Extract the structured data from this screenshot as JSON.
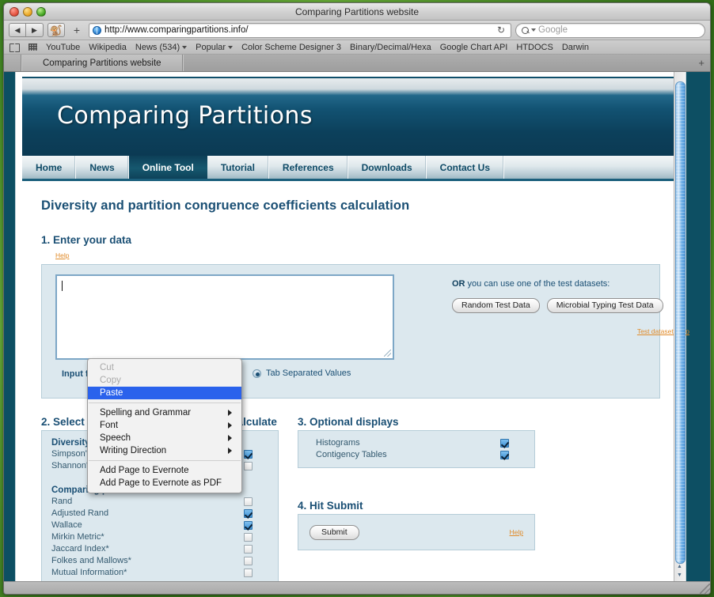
{
  "window": {
    "title": "Comparing Partitions website",
    "traffic_lights": [
      "close",
      "minimize",
      "zoom"
    ]
  },
  "toolbar": {
    "back_icon": "back-arrow-icon",
    "forward_icon": "forward-arrow-icon",
    "evernote_icon": "evernote-elephant-icon",
    "plus_label": "+",
    "url": "http://www.comparingpartitions.info/",
    "reload_glyph": "↻",
    "search_placeholder": "Google"
  },
  "bookmarks": [
    {
      "label": "YouTube",
      "menu": false
    },
    {
      "label": "Wikipedia",
      "menu": false
    },
    {
      "label": "News (534)",
      "menu": true
    },
    {
      "label": "Popular",
      "menu": true
    },
    {
      "label": "Color Scheme Designer 3",
      "menu": false
    },
    {
      "label": "Binary/Decimal/Hexa",
      "menu": false
    },
    {
      "label": "Google Chart API",
      "menu": false
    },
    {
      "label": "HTDOCS",
      "menu": false
    },
    {
      "label": "Darwin",
      "menu": false
    }
  ],
  "tabs": {
    "items": [
      {
        "label": "Comparing Partitions website",
        "active": true
      }
    ],
    "new_tab_label": "+"
  },
  "site": {
    "banner_title": "Comparing Partitions",
    "nav": [
      {
        "label": "Home",
        "active": false
      },
      {
        "label": "News",
        "active": false
      },
      {
        "label": "Online Tool",
        "active": true
      },
      {
        "label": "Tutorial",
        "active": false
      },
      {
        "label": "References",
        "active": false
      },
      {
        "label": "Downloads",
        "active": false
      },
      {
        "label": "Contact Us",
        "active": false
      }
    ],
    "page_title": "Diversity and partition congruence coefficients calculation",
    "step1": {
      "heading": "1. Enter your data",
      "help_label": "Help",
      "textarea_value": "",
      "input_format_label": "Input format:",
      "format_option_selected": "Tab Separated Values",
      "or_prefix": "OR",
      "or_text": " you can use one of the test datasets:",
      "random_button": "Random Test Data",
      "microbial_button": "Microbial Typing Test Data",
      "datasets_info_link": "Test datasets info"
    },
    "step2": {
      "heading": "2. Select the coefficients you want to calculate",
      "diversity_group": "Diversity measures:",
      "diversity_items": [
        {
          "label": "Simpson's Index of diversity",
          "checked": true
        },
        {
          "label": "Shannon's Index of diversity",
          "checked": false
        }
      ],
      "comparing_group": "Comparing partitions coefficients:",
      "comparing_items": [
        {
          "label": "Rand",
          "checked": false
        },
        {
          "label": "Adjusted Rand",
          "checked": true
        },
        {
          "label": "Wallace",
          "checked": true
        },
        {
          "label": "Mirkin Metric*",
          "checked": false
        },
        {
          "label": "Jaccard Index*",
          "checked": false
        },
        {
          "label": "Folkes and Mallows*",
          "checked": false
        },
        {
          "label": "Mutual Information*",
          "checked": false
        }
      ]
    },
    "step3": {
      "heading": "3. Optional displays",
      "items": [
        {
          "label": "Histograms",
          "checked": true
        },
        {
          "label": "Contigency Tables",
          "checked": true
        }
      ]
    },
    "step4": {
      "heading": "4. Hit Submit",
      "submit_label": "Submit",
      "help_label": "Help"
    }
  },
  "context_menu": {
    "items": [
      {
        "label": "Cut",
        "state": "disabled",
        "submenu": false
      },
      {
        "label": "Copy",
        "state": "disabled",
        "submenu": false
      },
      {
        "label": "Paste",
        "state": "selected",
        "submenu": false
      },
      {
        "separator": true
      },
      {
        "label": "Spelling and Grammar",
        "state": "normal",
        "submenu": true
      },
      {
        "label": "Font",
        "state": "normal",
        "submenu": true
      },
      {
        "label": "Speech",
        "state": "normal",
        "submenu": true
      },
      {
        "label": "Writing Direction",
        "state": "normal",
        "submenu": true
      },
      {
        "separator": true
      },
      {
        "label": "Add Page to Evernote",
        "state": "normal",
        "submenu": false
      },
      {
        "label": "Add Page to Evernote as PDF",
        "state": "normal",
        "submenu": false
      }
    ]
  },
  "colors": {
    "accent": "#1a4f74",
    "banner_dark": "#0b3a53",
    "help_link": "#e08b2a",
    "menu_highlight": "#2a62ec",
    "panel_bg": "#dce8ee"
  }
}
